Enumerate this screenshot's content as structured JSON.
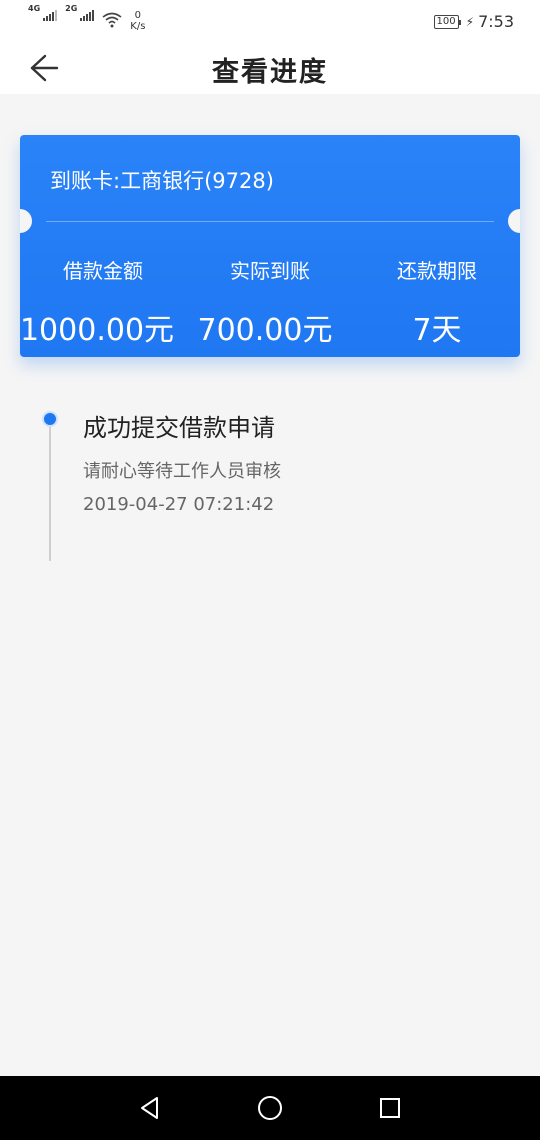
{
  "status_bar": {
    "network1": "4G",
    "network2": "2G",
    "speed_value": "0",
    "speed_unit": "K/s",
    "battery": "100",
    "time": "7:53"
  },
  "nav": {
    "title": "查看进度",
    "back_icon": "arrow-left-icon"
  },
  "card": {
    "title": "到账卡:工商银行(9728)",
    "stats": [
      {
        "label": "借款金额",
        "value": "1000.00元"
      },
      {
        "label": "实际到账",
        "value": "700.00元"
      },
      {
        "label": "还款期限",
        "value": "7天"
      }
    ],
    "colors": {
      "background": "#1f77f2"
    }
  },
  "timeline": {
    "items": [
      {
        "title": "成功提交借款申请",
        "description": "请耐心等待工作人员审核",
        "timestamp": "2019-04-27 07:21:42"
      }
    ],
    "dot_color": "#1f77f2"
  },
  "system_nav": {
    "back_icon": "triangle-back-icon",
    "home_icon": "circle-home-icon",
    "recent_icon": "square-recent-icon"
  }
}
